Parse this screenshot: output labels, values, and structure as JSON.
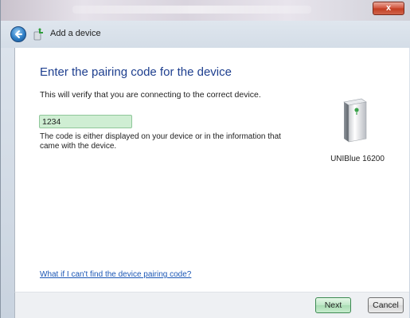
{
  "window": {
    "close_label": "x"
  },
  "nav": {
    "title": "Add a device"
  },
  "main": {
    "heading": "Enter the pairing code for the device",
    "subtext": "This will verify that you are connecting to the correct device.",
    "code_value": "1234",
    "hint": "The code is either displayed on your device or in the information that came with the device.",
    "help_link": "What if I can't find the device pairing code?"
  },
  "device": {
    "name": "UNIBlue 16200",
    "icon": "bluetooth-device-icon"
  },
  "buttons": {
    "next_label": "Next",
    "cancel_label": "Cancel"
  },
  "colors": {
    "heading": "#1e3f8f",
    "link": "#1a56b5",
    "input_bg": "#cfeed3"
  }
}
